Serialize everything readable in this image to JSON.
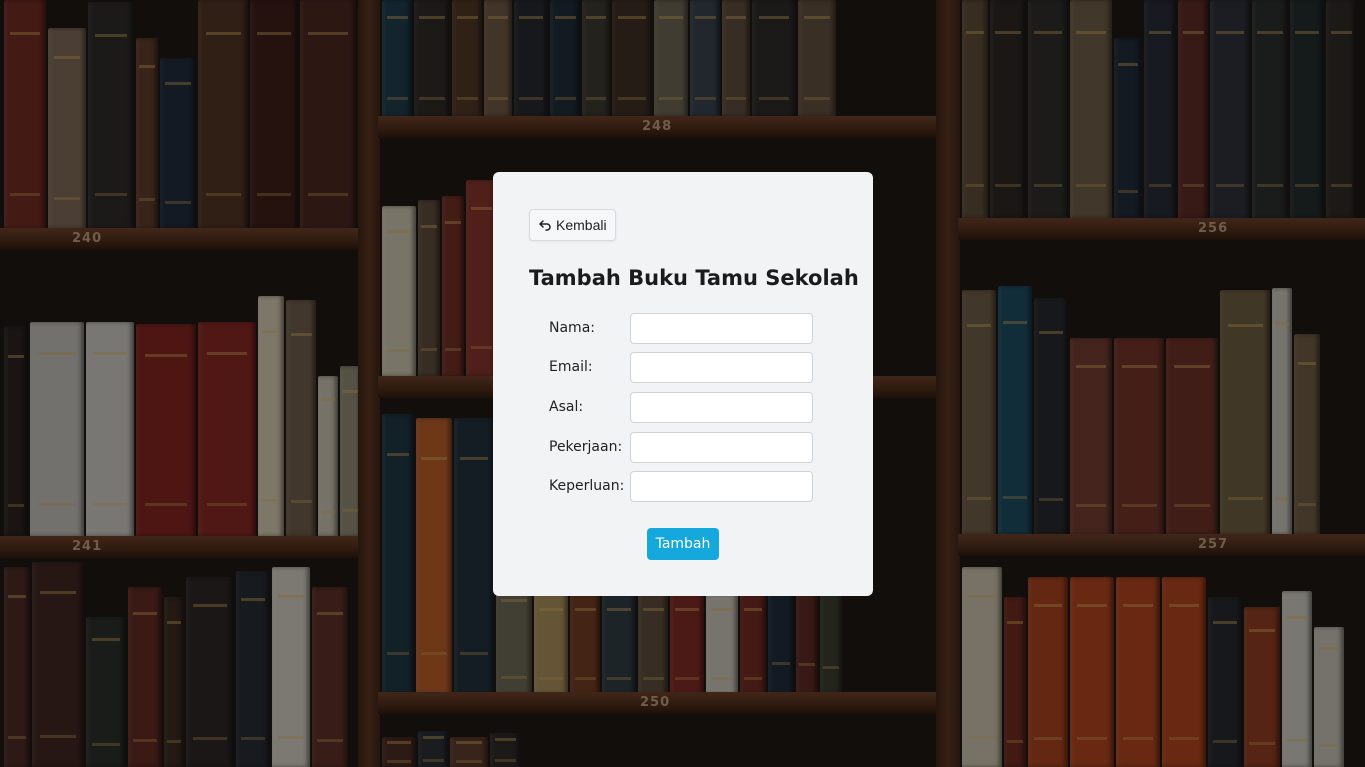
{
  "background": {
    "shelf_numbers": {
      "left_top": "240",
      "left_bottom": "241",
      "middle_top": "248",
      "middle_bottom": "250",
      "right_top": "256",
      "right_bottom": "257"
    }
  },
  "card": {
    "back_button": {
      "label": "Kembali",
      "icon": "back-arrow-icon"
    },
    "title": "Tambah Buku Tamu Sekolah",
    "fields": [
      {
        "label": "Nama:",
        "value": ""
      },
      {
        "label": "Email:",
        "value": ""
      },
      {
        "label": "Asal:",
        "value": ""
      },
      {
        "label": "Pekerjaan:",
        "value": ""
      },
      {
        "label": "Keperluan:",
        "value": ""
      }
    ],
    "submit_label": "Tambah",
    "colors": {
      "submit": "#14a8dd",
      "card": "#f2f3f5"
    }
  }
}
